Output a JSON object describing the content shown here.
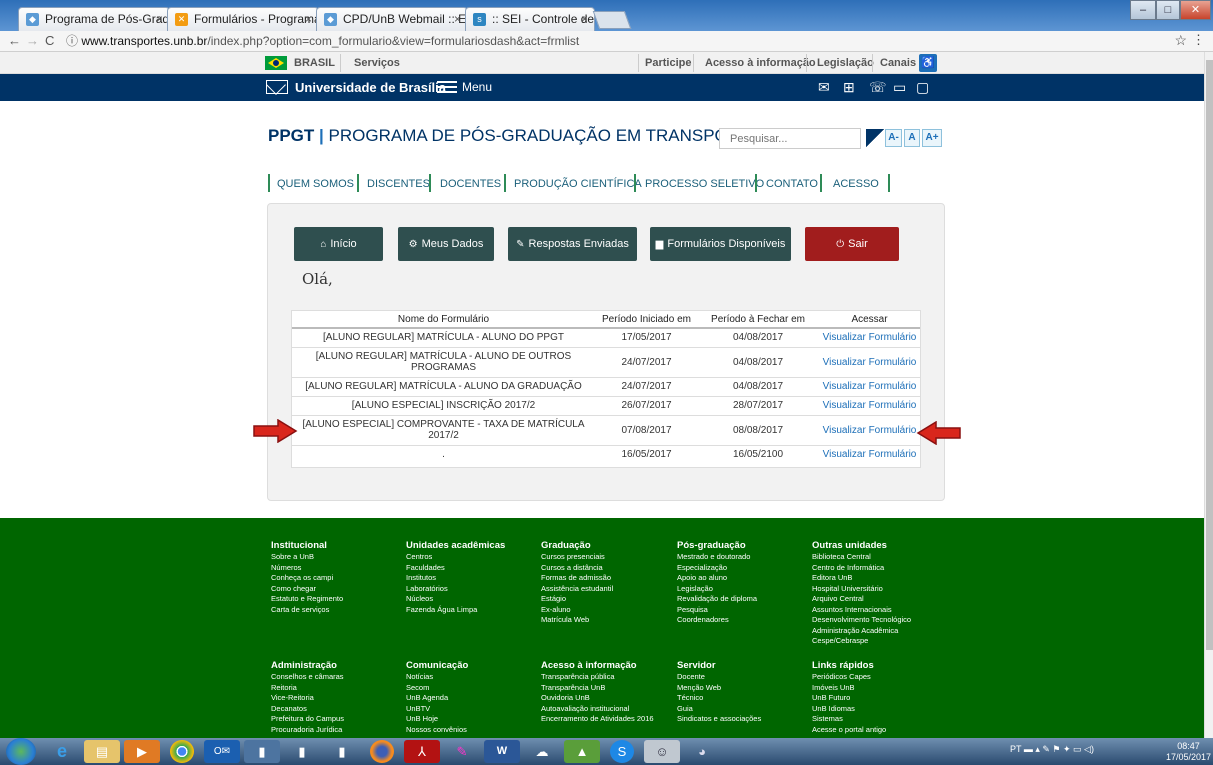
{
  "browser": {
    "tabs": [
      {
        "label": "Programa de Pós-Gradua",
        "fav": "unb-logo-icon",
        "color": "#5b9bd5"
      },
      {
        "label": "Formulários - Programa",
        "fav": "joomla-icon",
        "color": "#f39c12"
      },
      {
        "label": "CPD/UnB Webmail :: Env",
        "fav": "unb-logo-icon",
        "color": "#5b9bd5"
      },
      {
        "label": ":: SEI - Controle de Proce",
        "fav": "sei-icon",
        "color": "#2e86c1"
      }
    ],
    "url_host": "www.transportes.unb.br",
    "url_path": "/index.php?option=com_formulario&view=formulariosdash&act=frmlist"
  },
  "govbar": {
    "brasil": "BRASIL",
    "servicos": "Serviços",
    "links": [
      "Participe",
      "Acesso à informação",
      "Legislação",
      "Canais"
    ]
  },
  "unbbar": {
    "title": "Universidade de Brasília",
    "menu": "Menu"
  },
  "header": {
    "acronym": "PPGT",
    "separator": "|",
    "program": "PROGRAMA DE PÓS-GRADUAÇÃO EM TRANSPORTES",
    "search_placeholder": "Pesquisar...",
    "font_buttons": [
      "A-",
      "A",
      "A+"
    ]
  },
  "nav": [
    "QUEM SOMOS",
    "DISCENTES",
    "DOCENTES",
    "PRODUÇÃO CIENTÍFICA",
    "PROCESSO SELETIVO",
    "CONTATO",
    "ACESSO"
  ],
  "buttons": {
    "inicio": "Início",
    "meus_dados": "Meus Dados",
    "respostas": "Respostas Enviadas",
    "formularios": "Formulários Disponíveis",
    "sair": "Sair"
  },
  "greeting": "Olá,",
  "table": {
    "headers": [
      "Nome do Formulário",
      "Período Iniciado em",
      "Período à Fechar em",
      "Acessar"
    ],
    "rows": [
      {
        "name": "[ALUNO REGULAR] MATRÍCULA - ALUNO DO PPGT",
        "start": "17/05/2017",
        "end": "04/08/2017",
        "link": "Visualizar Formulário"
      },
      {
        "name": "[ALUNO REGULAR] MATRÍCULA - ALUNO DE OUTROS PROGRAMAS",
        "start": "24/07/2017",
        "end": "04/08/2017",
        "link": "Visualizar Formulário"
      },
      {
        "name": "[ALUNO REGULAR] MATRÍCULA - ALUNO DA GRADUAÇÃO",
        "start": "24/07/2017",
        "end": "04/08/2017",
        "link": "Visualizar Formulário"
      },
      {
        "name": "[ALUNO ESPECIAL] INSCRIÇÃO 2017/2",
        "start": "26/07/2017",
        "end": "28/07/2017",
        "link": "Visualizar Formulário"
      },
      {
        "name": "[ALUNO ESPECIAL] COMPROVANTE - TAXA DE MATRÍCULA 2017/2",
        "start": "07/08/2017",
        "end": "08/08/2017",
        "link": "Visualizar Formulário"
      },
      {
        "name": ".",
        "start": "16/05/2017",
        "end": "16/05/2100",
        "link": "Visualizar Formulário"
      }
    ]
  },
  "footer": {
    "columns": [
      {
        "title": "Institucional",
        "items": [
          "Sobre a UnB",
          "Números",
          "Conheça os campi",
          "Como chegar",
          "Estatuto e Regimento",
          "Carta de serviços"
        ]
      },
      {
        "title": "Unidades acadêmicas",
        "items": [
          "Centros",
          "Faculdades",
          "Institutos",
          "Laboratórios",
          "Núcleos",
          "Fazenda Água Limpa"
        ]
      },
      {
        "title": "Graduação",
        "items": [
          "Cursos presenciais",
          "Cursos a distância",
          "Formas de admissão",
          "Assistência estudantil",
          "Estágio",
          "Ex-aluno",
          "Matrícula Web"
        ]
      },
      {
        "title": "Pós-graduação",
        "items": [
          "Mestrado e doutorado",
          "Especialização",
          "Apoio ao aluno",
          "Legislação",
          "Revalidação de diploma",
          "Pesquisa",
          "Coordenadores"
        ]
      },
      {
        "title": "Outras unidades",
        "items": [
          "Biblioteca Central",
          "Centro de Informática",
          "Editora UnB",
          "Hospital Universitário",
          "Arquivo Central",
          "Assuntos Internacionais",
          "Desenvolvimento Tecnológico",
          "Administração Acadêmica",
          "Cespe/Cebraspe"
        ]
      },
      {
        "title": "Administração",
        "items": [
          "Conselhos e câmaras",
          "Reitoria",
          "Vice-Reitoria",
          "Decanatos",
          "Prefeitura do Campus",
          "Procuradoria Jurídica"
        ]
      },
      {
        "title": "Comunicação",
        "items": [
          "Notícias",
          "Secom",
          "UnB Agenda",
          "UnBTV",
          "UnB Hoje",
          "Nossos convênios"
        ]
      },
      {
        "title": "Acesso à informação",
        "items": [
          "Transparência pública",
          "Transparência UnB",
          "Ouvidoria UnB",
          "Autoavaliação institucional",
          "Encerramento de Atividades 2016"
        ]
      },
      {
        "title": "Servidor",
        "items": [
          "Docente",
          "Menção Web",
          "Técnico",
          "Guia",
          "Sindicatos e associações"
        ]
      },
      {
        "title": "Links rápidos",
        "items": [
          "Periódicos Capes",
          "Imóveis UnB",
          "UnB Futuro",
          "UnB Idiomas",
          "Sistemas",
          "Acesse o portal antigo"
        ]
      }
    ]
  },
  "taskbar": {
    "tray": "PT",
    "time": "08:47",
    "date": "17/05/2017"
  }
}
